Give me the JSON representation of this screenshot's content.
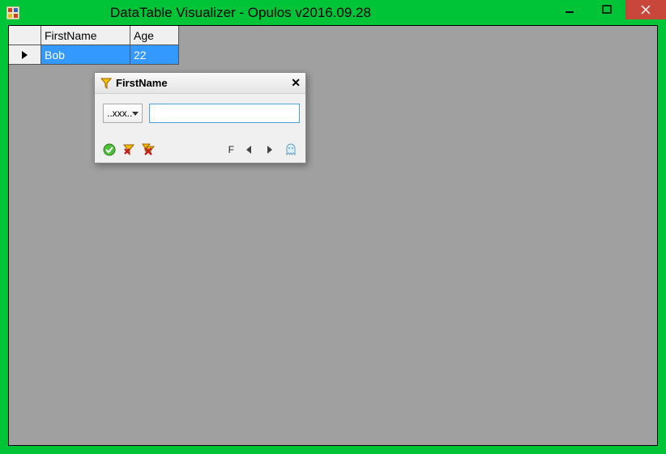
{
  "window": {
    "title": "DataTable Visualizer - Opulos v2016.09.28"
  },
  "grid": {
    "columns": [
      "FirstName",
      "Age"
    ],
    "rows": [
      {
        "FirstName": "Bob",
        "Age": "22"
      }
    ]
  },
  "filter_popup": {
    "title": "FirstName",
    "operator": "..xxx..",
    "value": "",
    "close_glyph": "✕",
    "nav_label": "F"
  },
  "icons": {
    "funnel": "filter-icon",
    "ok": "accept-icon",
    "clear1": "clear-filter-icon",
    "clear2": "clear-all-icon",
    "ghost": "ghost-icon"
  }
}
